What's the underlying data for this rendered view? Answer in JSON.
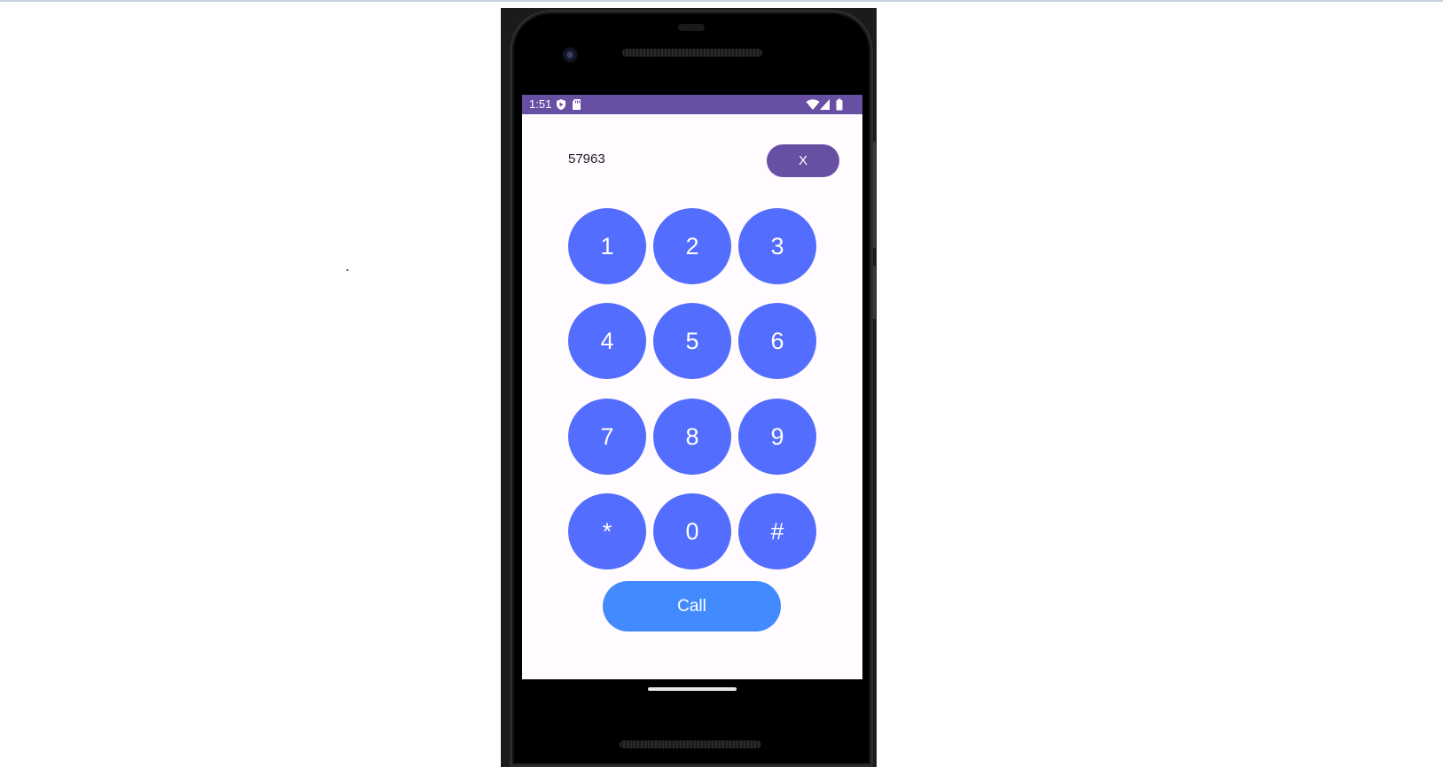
{
  "status_bar": {
    "time": "1:51",
    "left_icons": [
      "play-protect-icon",
      "sd-card-icon"
    ],
    "right_icons": [
      "wifi-icon",
      "cell-signal-icon",
      "battery-icon"
    ],
    "color": "#6750a4"
  },
  "dialer": {
    "number": "57963",
    "clear_label": "X",
    "keys": [
      "1",
      "2",
      "3",
      "4",
      "5",
      "6",
      "7",
      "8",
      "9",
      "*",
      "0",
      "#"
    ],
    "call_label": "Call",
    "colors": {
      "key": "#536dfe",
      "call": "#448aff",
      "clear": "#6750a4",
      "background": "#fffbfe"
    }
  }
}
